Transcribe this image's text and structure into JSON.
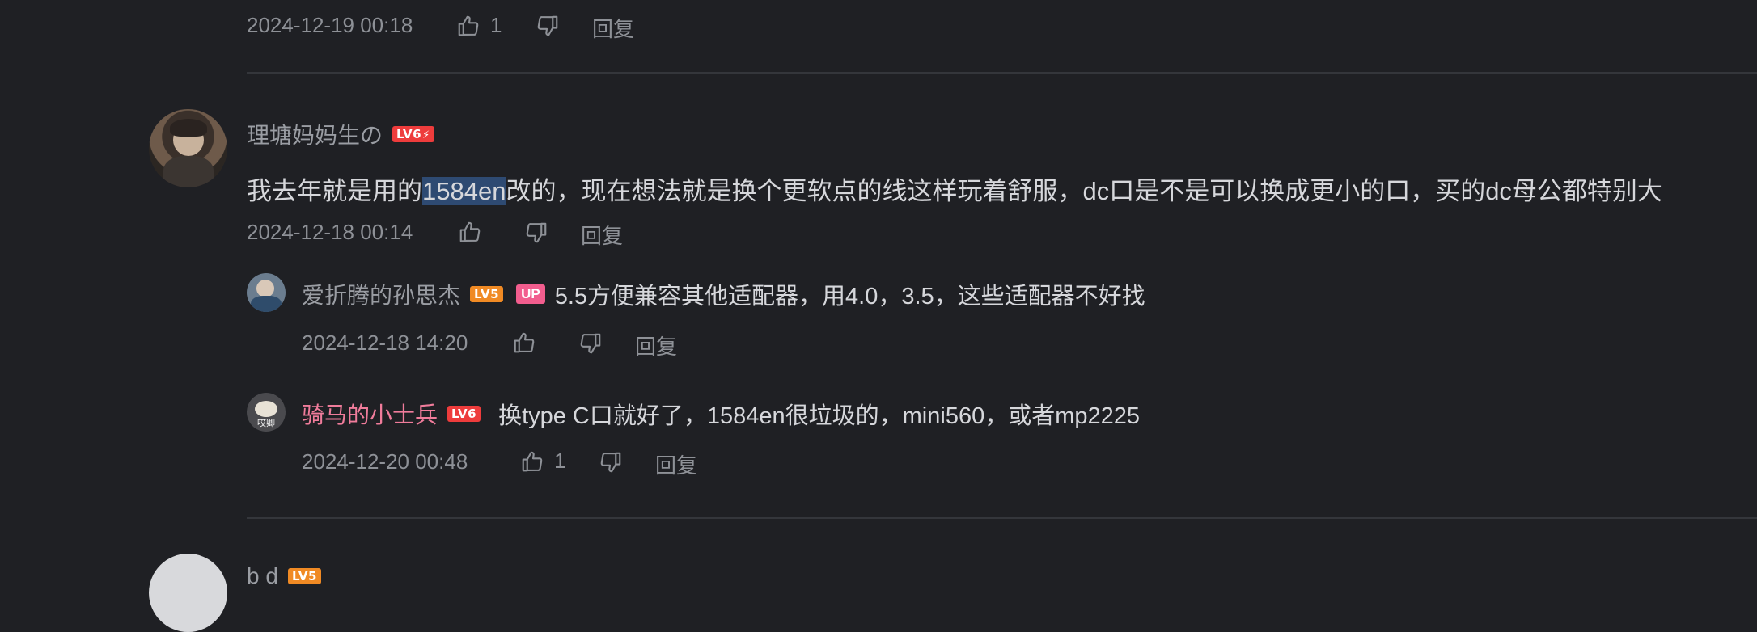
{
  "comments": [
    {
      "time": "2024-12-19 00:18",
      "like_count": "1",
      "reply_label": "回复"
    },
    {
      "username": "理塘妈妈生の",
      "level": "LV6",
      "text_before": "我去年就是用的",
      "text_selected": "1584en",
      "text_after": "改的，现在想法就是换个更软点的线这样玩着舒服，dc口是不是可以换成更小的口，买的dc母公都特别大",
      "time": "2024-12-18 00:14",
      "like_count": "",
      "reply_label": "回复",
      "replies": [
        {
          "username": "爱折腾的孙思杰",
          "level": "LV5",
          "up_badge": "UP",
          "text": "5.5方便兼容其他适配器，用4.0，3.5，这些适配器不好找",
          "time": "2024-12-18 14:20",
          "like_count": "",
          "reply_label": "回复"
        },
        {
          "username": "骑马的小士兵",
          "level": "LV6",
          "avatar_caption": "哎卿",
          "text": "换type C口就好了，1584en很垃圾的，mini560，或者mp2225",
          "time": "2024-12-20 00:48",
          "like_count": "1",
          "reply_label": "回复"
        }
      ]
    },
    {
      "username": "b d",
      "level": "LV5"
    }
  ],
  "colors": {
    "background": "#1f2024",
    "selection": "#2e4a72",
    "vip_name": "#f07c9b",
    "up_badge": "#f25d8e",
    "level6": "#ee3c3c",
    "level5": "#f08a24"
  }
}
